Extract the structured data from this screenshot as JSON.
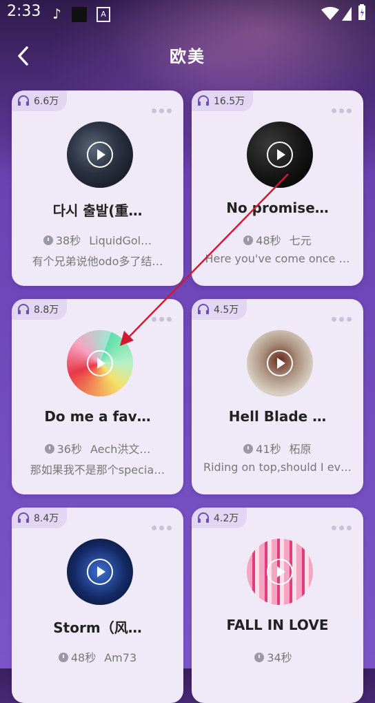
{
  "status_bar": {
    "time": "2:33"
  },
  "header": {
    "title": "欧美"
  },
  "cards": [
    {
      "plays": "6.6万",
      "title": "다시 출발(重…",
      "duration": "38秒",
      "artist": "LiquidGol…",
      "desc": "有个兄弟说他odo多了结…"
    },
    {
      "plays": "16.5万",
      "title": "No promise…",
      "duration": "48秒",
      "artist": "七元",
      "desc": "Here you've come once …"
    },
    {
      "plays": "8.8万",
      "title": "Do me a fav…",
      "duration": "36秒",
      "artist": "Aech洪文…",
      "desc": "那如果我不是那个specia…"
    },
    {
      "plays": "4.5万",
      "title": "Hell Blade …",
      "duration": "41秒",
      "artist": "柘原",
      "desc": "Riding on top,should I ev…"
    },
    {
      "plays": "8.4万",
      "title": "Storm（风…",
      "duration": "48秒",
      "artist": "Am73",
      "desc": ""
    },
    {
      "plays": "4.2万",
      "title": "FALL IN LOVE",
      "duration": "34秒",
      "artist": "",
      "desc": ""
    }
  ],
  "colors": {
    "accent": "#7b55c8",
    "card_bg": "#efe9f8",
    "badge_bg": "#e2d6f3",
    "arrow": "#d1192f"
  },
  "icons": [
    "back-arrow-icon",
    "headphones-icon",
    "more-dots-icon",
    "clock-icon",
    "play-icon"
  ]
}
